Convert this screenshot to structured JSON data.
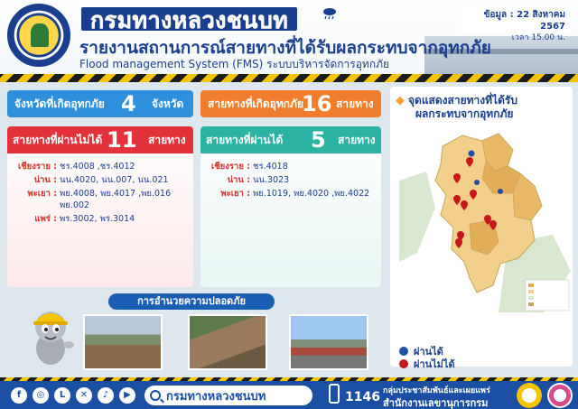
{
  "header": {
    "brand": "กรมทางหลวงชนบท",
    "title": "รายงานสถานการณ์สายทางที่ได้รับผลกระทบจากอุทกภัย",
    "subtitle_en": "Flood management System (FMS) ระบบบริหารจัดการอุทกภัย",
    "date": "ข้อมูล : 22 สิงหาคม 2567",
    "time": "เวลา 15.00 น."
  },
  "stats": {
    "provinces": {
      "label": "จังหวัดที่เกิดอุทกภัย",
      "value": "4",
      "unit": "จังหวัด"
    },
    "affected_roads": {
      "label": "สายทางที่เกิดอุทกภัย",
      "value": "16",
      "unit": "สายทาง"
    },
    "impassable": {
      "label": "สายทางที่ผ่านไม่ได้",
      "value": "11",
      "unit": "สายทาง"
    },
    "passable": {
      "label": "สายทางที่ผ่านได้",
      "value": "5",
      "unit": "สายทาง"
    }
  },
  "impassable_list": [
    {
      "province": "เชียงราย :",
      "roads": "ชร.4008 ,ชร.4012"
    },
    {
      "province": "น่าน :",
      "roads": "นน.4020, นน.007, นน.021"
    },
    {
      "province": "พะเยา :",
      "roads": "พย.4008, พย.4017 ,พย.016 พย.002"
    },
    {
      "province": "แพร่ :",
      "roads": "พร.3002, พร.3014"
    }
  ],
  "passable_list": [
    {
      "province": "เชียงราย :",
      "roads": "ชร.4018"
    },
    {
      "province": "น่าน :",
      "roads": "นน.3023"
    },
    {
      "province": "พะเยา :",
      "roads": "พย.1019, พย.4020 ,พย.4022"
    }
  ],
  "map": {
    "title_line1": "จุดแสดงสายทางที่ได้รับ",
    "title_line2": "ผลกระทบจากอุทกภัย",
    "legend_passable": "ผ่านได้",
    "legend_impassable": "ผ่านไม่ได้",
    "color_passable": "#1f4fa8",
    "color_impassable": "#c8161d"
  },
  "safety": {
    "title": "การอำนวยความปลอดภัย"
  },
  "footer": {
    "social_icons": [
      "facebook-icon",
      "instagram-icon",
      "line-icon",
      "x-icon",
      "tiktok-icon",
      "youtube-icon"
    ],
    "search_text": "กรมทางหลวงชนบท",
    "hotline": "1146",
    "dept_line1": "กลุ่มประชาสัมพันธ์และเผยแพร่",
    "dept_line2": "สำนักงานเลขานุการกรม"
  }
}
